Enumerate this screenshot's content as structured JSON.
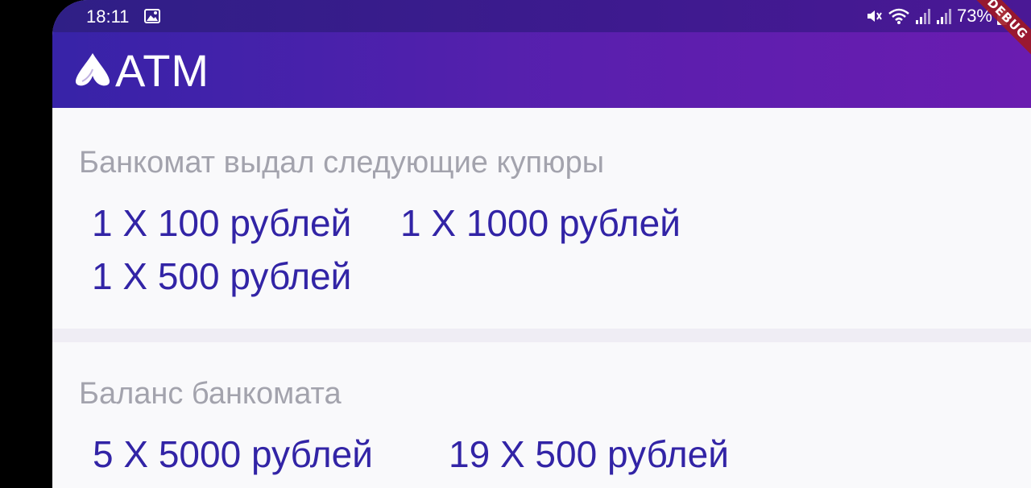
{
  "status_bar": {
    "time": "18:11",
    "battery": "73%",
    "icons": [
      "image-icon",
      "mute-icon",
      "wifi-icon",
      "signal-icon",
      "signal-icon-2"
    ]
  },
  "app_bar": {
    "title": "ATM",
    "logo": "atm-logo-icon",
    "debug_banner": "DEBUG"
  },
  "dispensed": {
    "label": "Банкомат выдал следующие купюры",
    "bills": [
      "1 X 100 рублей",
      "1 X 1000 рублей",
      "1 X 500 рублей"
    ]
  },
  "balance": {
    "label": "Баланс банкомата",
    "bills": [
      "5 X 5000 рублей",
      "19 X 500 рублей"
    ]
  },
  "colors": {
    "app_bar_start": "#3723a8",
    "app_bar_end": "#6a1cb0",
    "bill_text": "#3224a6",
    "label_text": "#a3a3ad",
    "background": "#f9f9fb"
  }
}
